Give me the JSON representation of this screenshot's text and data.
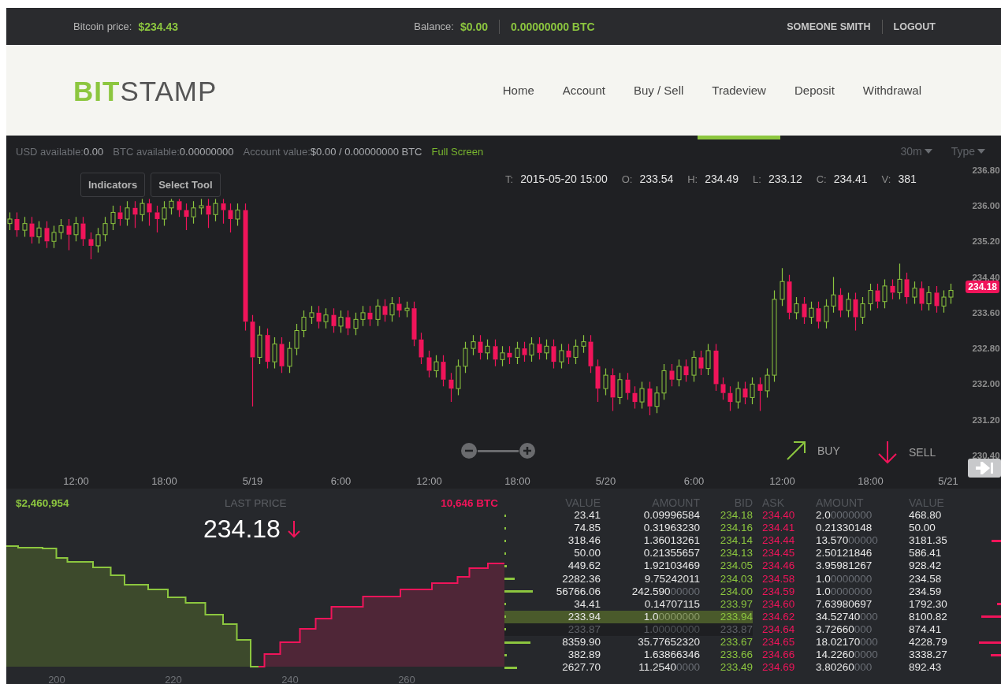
{
  "top_bar": {
    "price_label": "Bitcoin price:",
    "price": "$234.43",
    "balance_label": "Balance:",
    "balance_usd": "$0.00",
    "balance_btc": "0.00000000 BTC",
    "user": "SOMEONE SMITH",
    "logout": "LOGOUT"
  },
  "header": {
    "logo_highlight": "BIT",
    "logo_rest": "STAMP",
    "nav": [
      {
        "label": "Home",
        "selected": false
      },
      {
        "label": "Account",
        "selected": false
      },
      {
        "label": "Buy / Sell",
        "selected": false
      },
      {
        "label": "Tradeview",
        "selected": true
      },
      {
        "label": "Deposit",
        "selected": false
      },
      {
        "label": "Withdrawal",
        "selected": false
      }
    ]
  },
  "chart_toolbar": {
    "stats": [
      {
        "label": "USD available:",
        "value": "0.00"
      },
      {
        "label": "BTC available:",
        "value": "0.00000000"
      },
      {
        "label": "Account value:",
        "value": "$0.00 / 0.00000000 BTC"
      }
    ],
    "full_screen": "Full Screen",
    "interval": "30m",
    "type": "Type"
  },
  "chart": {
    "buttons": [
      "Indicators",
      "Select Tool"
    ],
    "ohlc": [
      {
        "label": "T:",
        "value": "2015-05-20 15:00"
      },
      {
        "label": "O:",
        "value": "233.54"
      },
      {
        "label": "H:",
        "value": "234.49"
      },
      {
        "label": "L:",
        "value": "233.12"
      },
      {
        "label": "C:",
        "value": "234.41"
      },
      {
        "label": "V:",
        "value": "381"
      }
    ],
    "chart_data": {
      "type": "candlestick",
      "categories": [
        null,
        null,
        null,
        null,
        null,
        null,
        null,
        null,
        null,
        "12:00",
        null,
        null,
        null,
        null,
        null,
        null,
        null,
        null,
        null,
        null,
        null,
        "18:00",
        null,
        null,
        null,
        null,
        null,
        null,
        null,
        null,
        null,
        null,
        null,
        "5/19",
        null,
        null,
        null,
        null,
        null,
        null,
        null,
        null,
        null,
        null,
        null,
        "6:00",
        null,
        null,
        null,
        null,
        null,
        null,
        null,
        null,
        null,
        null,
        null,
        "12:00",
        null,
        null,
        null,
        null,
        null,
        null,
        null,
        null,
        null,
        null,
        null,
        "18:00",
        null,
        null,
        null,
        null,
        null,
        null,
        null,
        null,
        null,
        null,
        null,
        "5/20",
        null,
        null,
        null,
        null,
        null,
        null,
        null,
        null,
        null,
        null,
        null,
        "6:00",
        null,
        null,
        null,
        null,
        null,
        null,
        null,
        null,
        null,
        null,
        null,
        "12:00",
        null,
        null,
        null,
        null,
        null,
        null,
        null,
        null,
        null,
        null,
        null,
        "18:00",
        null,
        null,
        null,
        null,
        null,
        null,
        null,
        null,
        null,
        null,
        "5/21"
      ],
      "ohlc": [
        [
          235.6,
          235.85,
          235.45,
          235.7
        ],
        [
          235.7,
          235.85,
          235.3,
          235.45
        ],
        [
          235.45,
          235.75,
          235.3,
          235.6
        ],
        [
          235.6,
          235.75,
          235.15,
          235.3
        ],
        [
          235.3,
          235.65,
          235.15,
          235.5
        ],
        [
          235.5,
          235.65,
          235.05,
          235.2
        ],
        [
          235.2,
          235.55,
          235.05,
          235.4
        ],
        [
          235.4,
          235.7,
          235.25,
          235.55
        ],
        [
          235.55,
          235.7,
          235.0,
          235.35
        ],
        [
          235.35,
          235.75,
          235.2,
          235.6
        ],
        [
          235.6,
          235.75,
          235.1,
          235.25
        ],
        [
          235.25,
          235.4,
          234.8,
          235.1
        ],
        [
          235.1,
          235.5,
          234.95,
          235.35
        ],
        [
          235.35,
          235.75,
          235.2,
          235.6
        ],
        [
          235.6,
          236.0,
          235.45,
          235.85
        ],
        [
          235.85,
          236.0,
          235.55,
          235.7
        ],
        [
          235.7,
          236.1,
          235.55,
          235.95
        ],
        [
          235.95,
          236.1,
          235.5,
          235.8
        ],
        [
          235.8,
          236.15,
          235.65,
          236.05
        ],
        [
          236.05,
          236.15,
          235.55,
          235.85
        ],
        [
          235.85,
          236.0,
          235.4,
          235.7
        ],
        [
          235.7,
          236.1,
          235.55,
          235.95
        ],
        [
          235.95,
          236.15,
          235.8,
          236.1
        ],
        [
          236.1,
          236.15,
          235.75,
          235.9
        ],
        [
          235.9,
          236.05,
          235.45,
          235.75
        ],
        [
          235.75,
          236.1,
          235.6,
          235.95
        ],
        [
          235.95,
          236.15,
          235.8,
          236.0
        ],
        [
          236.0,
          236.15,
          235.5,
          235.8
        ],
        [
          235.8,
          236.15,
          235.65,
          236.05
        ],
        [
          236.05,
          236.15,
          235.6,
          235.9
        ],
        [
          235.9,
          236.05,
          235.4,
          235.7
        ],
        [
          235.7,
          236.05,
          235.55,
          235.9
        ],
        [
          235.9,
          236.05,
          233.2,
          233.4
        ],
        [
          233.4,
          233.55,
          231.5,
          232.6
        ],
        [
          232.6,
          233.3,
          232.45,
          233.1
        ],
        [
          233.1,
          233.25,
          232.35,
          232.5
        ],
        [
          232.5,
          233.05,
          232.35,
          232.9
        ],
        [
          232.9,
          233.05,
          232.25,
          232.4
        ],
        [
          232.4,
          232.95,
          232.25,
          232.8
        ],
        [
          232.8,
          233.35,
          232.65,
          233.2
        ],
        [
          233.2,
          233.65,
          233.05,
          233.5
        ],
        [
          233.5,
          233.75,
          233.35,
          233.6
        ],
        [
          233.6,
          233.75,
          233.25,
          233.4
        ],
        [
          233.4,
          233.7,
          233.25,
          233.55
        ],
        [
          233.55,
          233.7,
          233.15,
          233.3
        ],
        [
          233.3,
          233.65,
          233.15,
          233.5
        ],
        [
          233.5,
          233.65,
          233.1,
          233.25
        ],
        [
          233.25,
          233.6,
          233.1,
          233.45
        ],
        [
          233.45,
          233.75,
          233.3,
          233.6
        ],
        [
          233.6,
          233.75,
          233.3,
          233.45
        ],
        [
          233.45,
          233.9,
          233.3,
          233.75
        ],
        [
          233.75,
          233.9,
          233.4,
          233.55
        ],
        [
          233.55,
          233.95,
          233.4,
          233.8
        ],
        [
          233.8,
          233.95,
          233.5,
          233.65
        ],
        [
          233.65,
          233.85,
          233.5,
          233.7
        ],
        [
          233.7,
          233.85,
          232.85,
          233.0
        ],
        [
          233.0,
          233.15,
          232.45,
          232.6
        ],
        [
          232.6,
          232.75,
          232.15,
          232.3
        ],
        [
          232.3,
          232.65,
          232.15,
          232.5
        ],
        [
          232.5,
          232.65,
          231.95,
          232.1
        ],
        [
          232.1,
          232.25,
          231.6,
          231.9
        ],
        [
          231.9,
          232.55,
          231.75,
          232.4
        ],
        [
          232.4,
          232.95,
          232.25,
          232.8
        ],
        [
          232.8,
          233.1,
          232.65,
          232.95
        ],
        [
          232.95,
          233.1,
          232.55,
          232.7
        ],
        [
          232.7,
          233.0,
          232.55,
          232.85
        ],
        [
          232.85,
          233.0,
          232.4,
          232.55
        ],
        [
          232.55,
          232.85,
          232.4,
          232.7
        ],
        [
          232.7,
          232.85,
          232.45,
          232.6
        ],
        [
          232.6,
          232.95,
          232.45,
          232.8
        ],
        [
          232.8,
          232.95,
          232.5,
          232.65
        ],
        [
          232.65,
          233.05,
          232.5,
          232.9
        ],
        [
          232.9,
          233.05,
          232.55,
          232.7
        ],
        [
          232.7,
          233.0,
          232.55,
          232.85
        ],
        [
          232.85,
          233.0,
          232.35,
          232.5
        ],
        [
          232.5,
          232.9,
          232.35,
          232.75
        ],
        [
          232.75,
          232.9,
          232.45,
          232.6
        ],
        [
          232.6,
          233.0,
          232.45,
          232.85
        ],
        [
          232.85,
          233.1,
          232.7,
          232.95
        ],
        [
          232.95,
          233.1,
          232.25,
          232.4
        ],
        [
          232.4,
          232.55,
          231.6,
          231.9
        ],
        [
          231.9,
          232.35,
          231.75,
          232.2
        ],
        [
          232.2,
          232.35,
          231.4,
          231.7
        ],
        [
          231.7,
          232.25,
          231.55,
          232.1
        ],
        [
          232.1,
          232.25,
          231.65,
          231.8
        ],
        [
          231.8,
          231.95,
          231.45,
          231.6
        ],
        [
          231.6,
          232.05,
          231.45,
          231.9
        ],
        [
          231.9,
          232.05,
          231.3,
          231.5
        ],
        [
          231.5,
          231.95,
          231.35,
          231.8
        ],
        [
          231.8,
          232.45,
          231.65,
          232.3
        ],
        [
          232.3,
          232.45,
          231.95,
          232.1
        ],
        [
          232.1,
          232.55,
          231.95,
          232.4
        ],
        [
          232.4,
          232.55,
          232.05,
          232.2
        ],
        [
          232.2,
          232.75,
          232.05,
          232.6
        ],
        [
          232.6,
          232.75,
          232.2,
          232.35
        ],
        [
          232.35,
          232.9,
          232.2,
          232.75
        ],
        [
          232.75,
          232.9,
          231.85,
          232.0
        ],
        [
          232.0,
          232.15,
          231.65,
          231.8
        ],
        [
          231.8,
          231.95,
          231.4,
          231.6
        ],
        [
          231.6,
          232.05,
          231.45,
          231.9
        ],
        [
          231.9,
          232.05,
          231.55,
          231.7
        ],
        [
          231.7,
          232.15,
          231.55,
          232.0
        ],
        [
          232.0,
          232.15,
          231.4,
          231.85
        ],
        [
          231.85,
          232.35,
          231.7,
          232.2
        ],
        [
          232.2,
          234.1,
          232.05,
          233.9
        ],
        [
          233.9,
          234.6,
          233.75,
          234.3
        ],
        [
          234.3,
          234.45,
          233.45,
          233.6
        ],
        [
          233.6,
          233.95,
          233.45,
          233.8
        ],
        [
          233.8,
          233.95,
          233.35,
          233.5
        ],
        [
          233.5,
          233.85,
          233.35,
          233.7
        ],
        [
          233.7,
          233.85,
          233.25,
          233.4
        ],
        [
          233.4,
          233.9,
          233.25,
          233.75
        ],
        [
          233.75,
          234.4,
          233.6,
          234.0
        ],
        [
          234.0,
          234.15,
          233.5,
          233.65
        ],
        [
          233.65,
          234.05,
          233.5,
          233.9
        ],
        [
          233.9,
          234.05,
          233.2,
          233.5
        ],
        [
          233.5,
          233.95,
          233.35,
          233.8
        ],
        [
          233.8,
          234.25,
          233.65,
          234.1
        ],
        [
          234.1,
          234.25,
          233.7,
          233.85
        ],
        [
          233.85,
          234.35,
          233.7,
          234.2
        ],
        [
          234.2,
          234.35,
          233.9,
          234.05
        ],
        [
          234.05,
          234.7,
          233.9,
          234.35
        ],
        [
          234.35,
          234.5,
          233.8,
          233.95
        ],
        [
          233.95,
          234.3,
          233.8,
          234.15
        ],
        [
          234.15,
          234.3,
          233.65,
          233.8
        ],
        [
          233.8,
          234.2,
          233.65,
          234.05
        ],
        [
          234.05,
          234.2,
          233.6,
          233.75
        ],
        [
          233.75,
          234.1,
          233.6,
          233.95
        ],
        [
          233.95,
          234.25,
          233.8,
          234.1
        ]
      ],
      "ylim": [
        230.4,
        236.8
      ],
      "yticks": [
        {
          "value": 236.8,
          "label": "236.80"
        },
        {
          "value": 236.0,
          "label": "236.00"
        },
        {
          "value": 235.2,
          "label": "235.20"
        },
        {
          "value": 234.4,
          "label": "234.40"
        },
        {
          "value": 233.6,
          "label": "233.60"
        },
        {
          "value": 232.8,
          "label": "232.80"
        },
        {
          "value": 232.0,
          "label": "232.00"
        },
        {
          "value": 231.2,
          "label": "231.20"
        },
        {
          "value": 230.4,
          "label": "230.40"
        }
      ]
    },
    "last_price_tag": "234.18",
    "buy": "BUY",
    "sell": "SELL"
  },
  "depth": {
    "bid_total": "$2,460,954",
    "last_price_label": "LAST PRICE",
    "last_price": "234.18",
    "ask_total": "10,646 BTC",
    "x_ticks": [
      "200",
      "220",
      "240",
      "260"
    ]
  },
  "order_book": {
    "columns": [
      "VALUE",
      "AMOUNT",
      "BID",
      "ASK",
      "AMOUNT",
      "VALUE"
    ],
    "rows": [
      {
        "bid_value": "23.41",
        "bid_amount": "0.09996584",
        "bid": "234.18",
        "ask": "234.40",
        "ask_amount": "2.0",
        "ask_amount_zeros": "0000000",
        "ask_value": "468.80",
        "selected": false,
        "muted": false
      },
      {
        "bid_value": "74.85",
        "bid_amount": "0.31963230",
        "bid": "234.16",
        "ask": "234.41",
        "ask_amount": "0.21330148",
        "ask_value": "50.00",
        "selected": false,
        "muted": false
      },
      {
        "bid_value": "318.46",
        "bid_amount": "1.36013261",
        "bid": "234.14",
        "ask": "234.44",
        "ask_amount": "13.570",
        "ask_amount_zeros": "00000",
        "ask_value": "3181.35",
        "selected": false,
        "muted": false
      },
      {
        "bid_value": "50.00",
        "bid_amount": "0.21355657",
        "bid": "234.13",
        "ask": "234.45",
        "ask_amount": "2.50121846",
        "ask_value": "586.41",
        "selected": false,
        "muted": false
      },
      {
        "bid_value": "449.62",
        "bid_amount": "1.92103469",
        "bid": "234.05",
        "ask": "234.46",
        "ask_amount": "3.95981267",
        "ask_value": "928.42",
        "selected": false,
        "muted": false
      },
      {
        "bid_value": "2282.36",
        "bid_amount": "9.75242011",
        "bid": "234.03",
        "ask": "234.58",
        "ask_amount": "1.0",
        "ask_amount_zeros": "0000000",
        "ask_value": "234.58",
        "selected": false,
        "muted": false
      },
      {
        "bid_value": "56766.06",
        "bid_amount": "242.590",
        "bid_amount_zeros": "00000",
        "bid": "234.00",
        "ask": "234.59",
        "ask_amount": "1.0",
        "ask_amount_zeros": "0000000",
        "ask_value": "234.59",
        "selected": false,
        "muted": false
      },
      {
        "bid_value": "34.41",
        "bid_amount": "0.14707115",
        "bid": "233.97",
        "ask": "234.60",
        "ask_amount": "7.63980697",
        "ask_value": "1792.30",
        "selected": false,
        "muted": false
      },
      {
        "bid_value": "233.94",
        "bid_amount": "1.0",
        "bid_amount_zeros": "0000000",
        "bid": "233.94",
        "ask": "234.62",
        "ask_amount": "34.52740",
        "ask_amount_zeros": "000",
        "ask_value": "8100.82",
        "selected": true,
        "muted": false
      },
      {
        "bid_value": "233.87",
        "bid_amount": "1.0",
        "bid_amount_zeros": "0000000",
        "bid": "233.87",
        "ask": "234.64",
        "ask_amount": "3.72660",
        "ask_amount_zeros": "000",
        "ask_value": "874.41",
        "selected": false,
        "muted": true
      },
      {
        "bid_value": "8359.90",
        "bid_amount": "35.77652320",
        "bid": "233.67",
        "ask": "234.65",
        "ask_amount": "18.02170",
        "ask_amount_zeros": "000",
        "ask_value": "4228.79",
        "selected": false,
        "muted": false
      },
      {
        "bid_value": "382.89",
        "bid_amount": "1.63866346",
        "bid": "233.66",
        "ask": "234.66",
        "ask_amount": "14.2260",
        "ask_amount_zeros": "0000",
        "ask_value": "3338.27",
        "selected": false,
        "muted": false
      },
      {
        "bid_value": "2627.70",
        "bid_amount": "11.2540",
        "bid_amount_zeros": "0000",
        "bid": "233.49",
        "ask": "234.69",
        "ask_amount": "3.80260",
        "ask_amount_zeros": "000",
        "ask_value": "892.43",
        "selected": false,
        "muted": false
      }
    ]
  }
}
